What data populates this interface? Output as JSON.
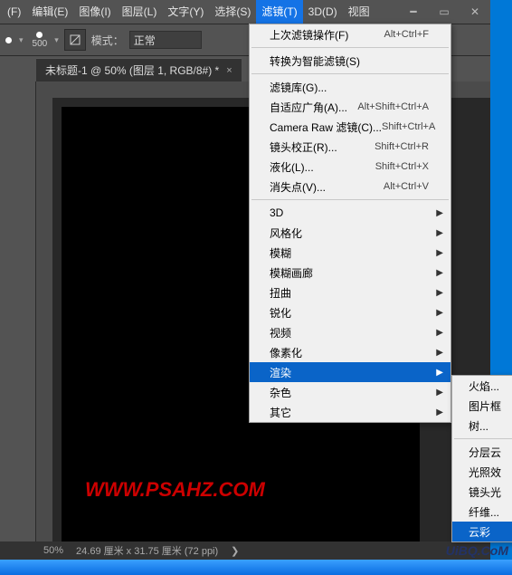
{
  "menubar": {
    "items": [
      "(F)",
      "编辑(E)",
      "图像(I)",
      "图层(L)",
      "文字(Y)",
      "选择(S)",
      "滤镜(T)",
      "3D(D)",
      "视图"
    ],
    "activeIndex": 6,
    "winbtns": {
      "min": "━",
      "max": "▭",
      "close": "✕"
    }
  },
  "toolbar": {
    "brushSize": "500",
    "modeLabel": "模式：",
    "modeValue": "正常"
  },
  "tab": {
    "title": "未标题-1 @ 50% (图层 1, RGB/8#) *",
    "close": "×"
  },
  "canvas": {
    "watermark": "WWW.PSAHZ.COM"
  },
  "status": {
    "zoom": "50%",
    "dim": "24.69 厘米 x 31.75 厘米 (72 ppi)",
    "arrow": "❯"
  },
  "filterMenu": {
    "section1": [
      {
        "label": "上次滤镜操作(F)",
        "sc": "Alt+Ctrl+F"
      }
    ],
    "section2": [
      {
        "label": "转换为智能滤镜(S)"
      }
    ],
    "section3": [
      {
        "label": "滤镜库(G)..."
      },
      {
        "label": "自适应广角(A)...",
        "sc": "Alt+Shift+Ctrl+A"
      },
      {
        "label": "Camera Raw 滤镜(C)...",
        "sc": "Shift+Ctrl+A"
      },
      {
        "label": "镜头校正(R)...",
        "sc": "Shift+Ctrl+R"
      },
      {
        "label": "液化(L)...",
        "sc": "Shift+Ctrl+X"
      },
      {
        "label": "消失点(V)...",
        "sc": "Alt+Ctrl+V"
      }
    ],
    "section4": [
      {
        "label": "3D",
        "sub": true
      },
      {
        "label": "风格化",
        "sub": true
      },
      {
        "label": "模糊",
        "sub": true
      },
      {
        "label": "模糊画廊",
        "sub": true
      },
      {
        "label": "扭曲",
        "sub": true
      },
      {
        "label": "锐化",
        "sub": true
      },
      {
        "label": "视频",
        "sub": true
      },
      {
        "label": "像素化",
        "sub": true
      },
      {
        "label": "渲染",
        "sub": true,
        "hl": true
      },
      {
        "label": "杂色",
        "sub": true
      },
      {
        "label": "其它",
        "sub": true
      }
    ]
  },
  "renderSubmenu": {
    "g1": [
      {
        "label": "火焰..."
      },
      {
        "label": "图片框"
      },
      {
        "label": "树..."
      }
    ],
    "g2": [
      {
        "label": "分层云"
      },
      {
        "label": "光照效"
      },
      {
        "label": "镜头光"
      },
      {
        "label": "纤维..."
      },
      {
        "label": "云彩",
        "hl": true
      }
    ]
  },
  "brand": "UiBQ.CoM",
  "glyph": {
    "arrow": "▶"
  }
}
